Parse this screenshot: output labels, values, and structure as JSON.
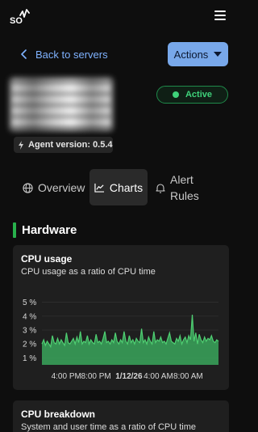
{
  "header": {
    "logo_alt": "SO",
    "menu_icon": "hamburger-menu-icon"
  },
  "nav": {
    "back_label": "Back to servers",
    "actions_label": "Actions"
  },
  "server": {
    "status": "Active",
    "agent_version": "Agent version: 0.5.4"
  },
  "tabs": [
    {
      "label": "Overview",
      "icon": "globe-icon",
      "active": false
    },
    {
      "label": "Charts",
      "icon": "chart-icon",
      "active": true
    },
    {
      "label": "Alert",
      "label2": "Rules",
      "icon": "bell-icon",
      "active": false
    }
  ],
  "section": {
    "title": "Hardware"
  },
  "cards": [
    {
      "title": "CPU usage",
      "subtitle": "CPU usage as a ratio of CPU time"
    },
    {
      "title": "CPU breakdown",
      "subtitle": "System and user time as a ratio of CPU time"
    }
  ],
  "colors": {
    "accent_blue": "#78a8ea",
    "link_blue": "#7fb2ff",
    "active_green": "#3fd27a",
    "section_green": "#28b14c",
    "series_green": "#4fcf72"
  },
  "chart_data": {
    "type": "area",
    "title": "CPU usage",
    "subtitle": "CPU usage as a ratio of CPU time",
    "xlabel": "",
    "ylabel": "",
    "y_ticks": [
      "5 %",
      "4 %",
      "3 %",
      "2 %",
      "1 %"
    ],
    "y_tick_values": [
      5,
      4,
      3,
      2,
      1
    ],
    "ylim": [
      0.5,
      5.5
    ],
    "x_ticks": [
      "4:00 PM",
      "8:00 PM",
      "1/12/26",
      "4:00 AM",
      "8:00 AM"
    ],
    "x_tick_fractions": [
      0.06,
      0.25,
      0.47,
      0.65,
      0.84
    ],
    "grid": true,
    "legend": "none",
    "series": [
      {
        "values": [
          2.0,
          2.3,
          1.9,
          2.2,
          2.0,
          1.8,
          2.6,
          2.1,
          2.0,
          2.4,
          2.0,
          2.3,
          2.1,
          1.9,
          2.8,
          2.1,
          2.0,
          2.2,
          2.4,
          2.0,
          2.5,
          2.1,
          2.9,
          2.0,
          2.2,
          2.1,
          2.6,
          2.0,
          2.3,
          2.1,
          2.0,
          2.7,
          2.1,
          2.2,
          2.0,
          2.4,
          2.9,
          2.1,
          2.2,
          2.0,
          2.3,
          2.1,
          2.8,
          2.2,
          2.0,
          2.3,
          2.1,
          2.9,
          2.2,
          2.0,
          2.6,
          2.1,
          2.3,
          2.0,
          2.4,
          2.2,
          2.1,
          3.1,
          2.1,
          2.3,
          2.0,
          2.5,
          2.2,
          2.0,
          2.9,
          2.1,
          2.3,
          2.2,
          2.5,
          2.1,
          2.2,
          2.0,
          2.4,
          2.8,
          2.2,
          2.1,
          2.0,
          2.4,
          2.2,
          2.6,
          2.0,
          2.3,
          2.5,
          2.1,
          2.6,
          2.3,
          4.1,
          2.2,
          2.8,
          2.0,
          2.7,
          2.3,
          2.1,
          2.5,
          2.2,
          2.4,
          2.3,
          2.6,
          2.2,
          2.1,
          2.3,
          2.2
        ]
      }
    ]
  }
}
